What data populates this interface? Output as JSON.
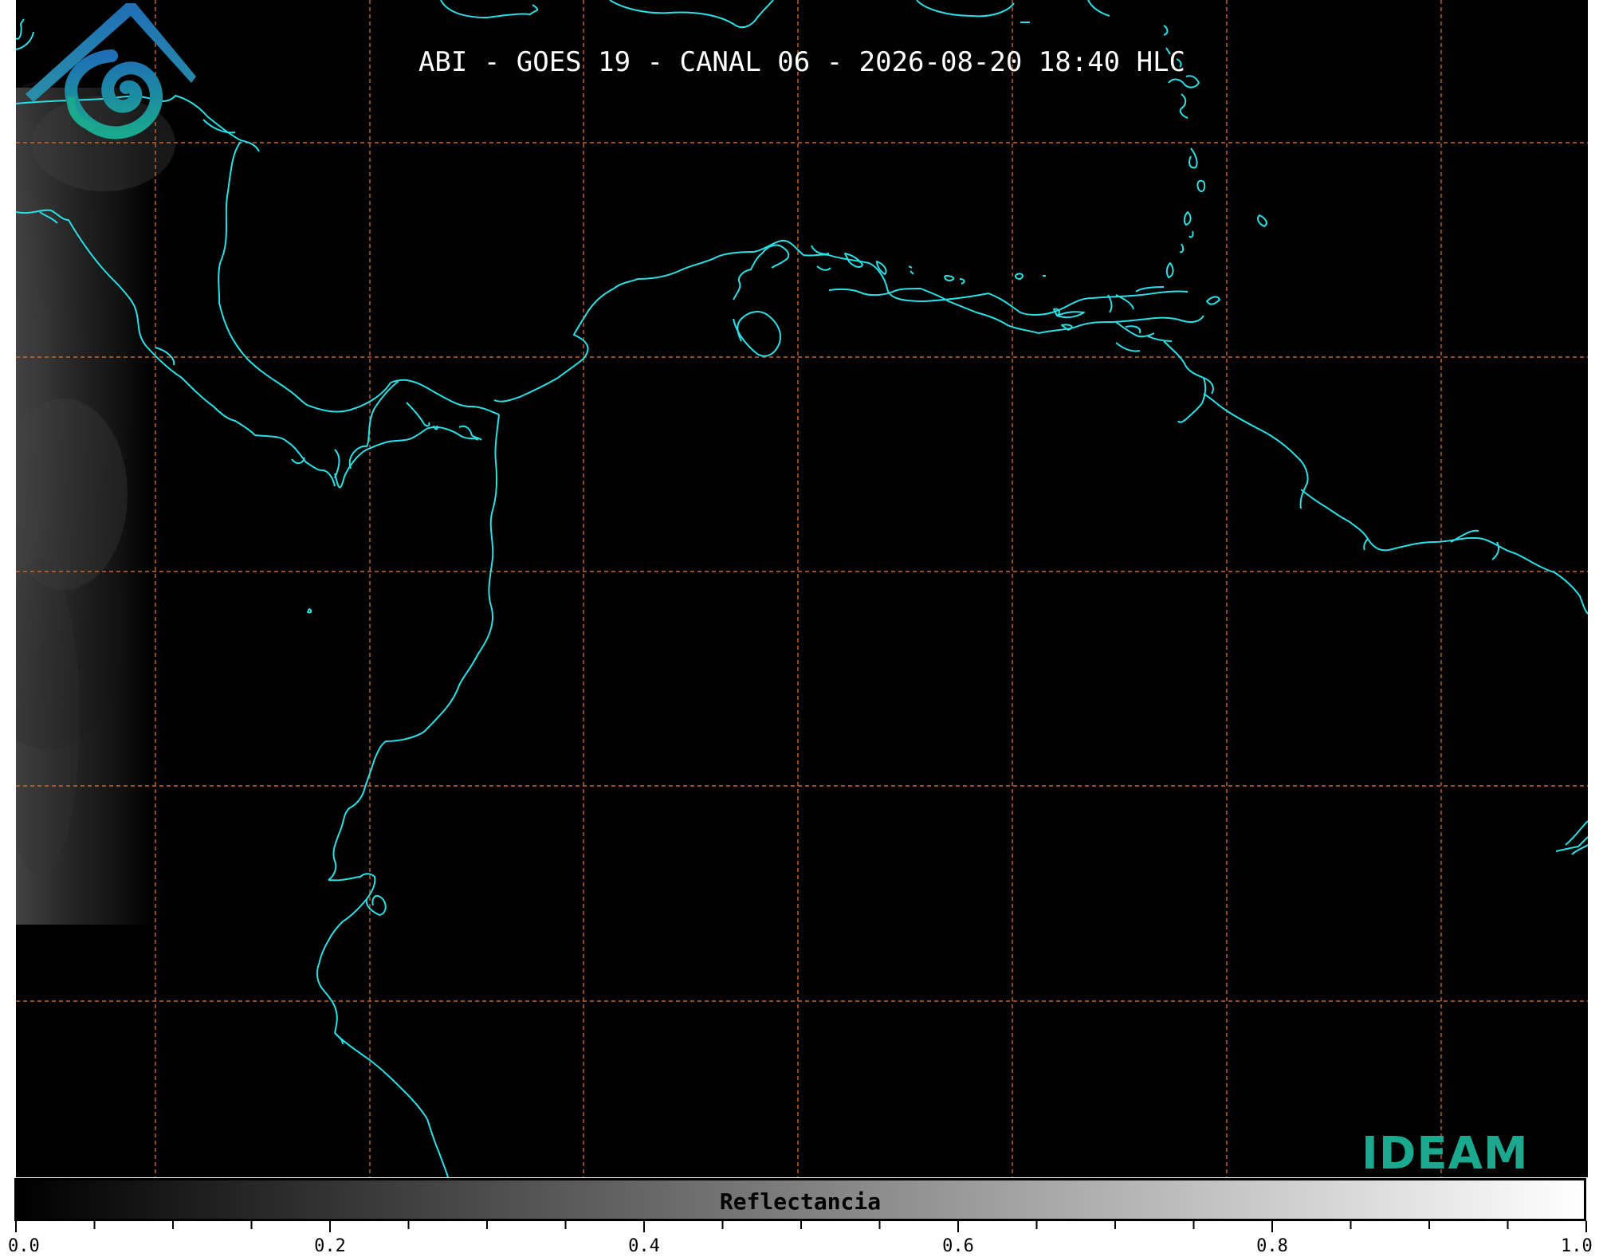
{
  "title": "ABI - GOES 19 - CANAL 06 - 2026-08-20 18:40 HLC",
  "colorbar": {
    "label": "Reflectancia",
    "ticks": [
      "0.0",
      "0.2",
      "0.4",
      "0.6",
      "0.8",
      "1.0"
    ],
    "range": [
      0.0,
      1.0
    ]
  },
  "logo": {
    "text": "IDEAM"
  },
  "colors": {
    "background": "#000000",
    "coastline": "#2be0e6",
    "gridlines": "#c8682a",
    "logo_blue": "#1f6fb5",
    "logo_green": "#1aa88e"
  }
}
